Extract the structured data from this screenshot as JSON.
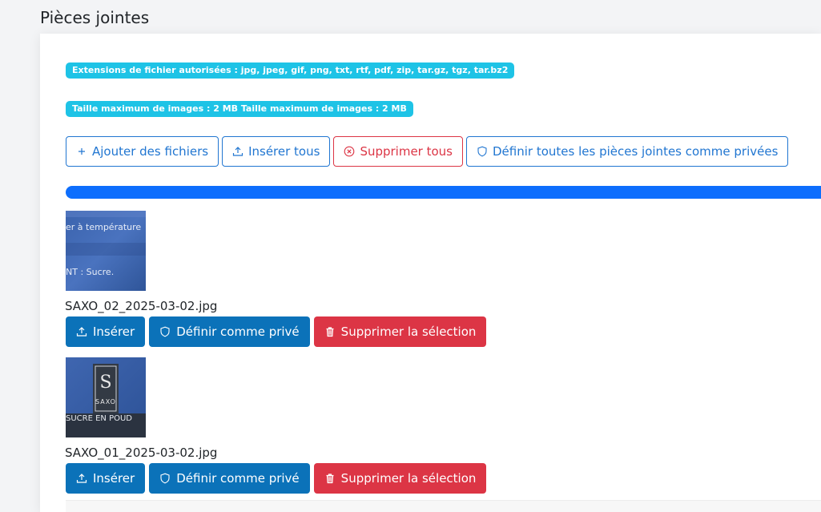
{
  "section": {
    "title": "Pièces jointes"
  },
  "info": {
    "extensions": "Extensions de fichier autorisées : jpg, jpeg, gif, png, txt, rtf, pdf, zip, tar.gz, tgz, tar.bz2",
    "max_size": "Taille maximum de images : 2 MB Taille maximum de images : 2 MB"
  },
  "toolbar": {
    "add_label": "Ajouter des fichiers",
    "insert_all_label": "Insérer tous",
    "delete_all_label": "Supprimer tous",
    "private_all_label": "Définir toutes les pièces jointes comme privées"
  },
  "upload": {
    "progress_percent": 100,
    "color": "#0d6efd"
  },
  "attachments": [
    {
      "filename": "SAXO_02_2025-03-02.jpg",
      "insert_label": "Insérer",
      "private_label": "Définir comme privé",
      "delete_label": "Supprimer la sélection",
      "thumb_text_1": "er à température",
      "thumb_text_2": "NT : Sucre."
    },
    {
      "filename": "SAXO_01_2025-03-02.jpg",
      "insert_label": "Insérer",
      "private_label": "Définir comme privé",
      "delete_label": "Supprimer la sélection",
      "thumb_logo": "S",
      "thumb_brand": "SAXO",
      "thumb_text": "SUCRE EN POUD"
    }
  ],
  "colors": {
    "primary": "#0b72b9",
    "outline_primary": "#2176d1",
    "danger": "#dc3545",
    "badge": "#1ec3e6"
  },
  "icons": {
    "add": "plus-icon",
    "insert": "upload-icon",
    "delete_all": "circle-x-icon",
    "private": "shield-icon",
    "delete": "trash-icon"
  }
}
